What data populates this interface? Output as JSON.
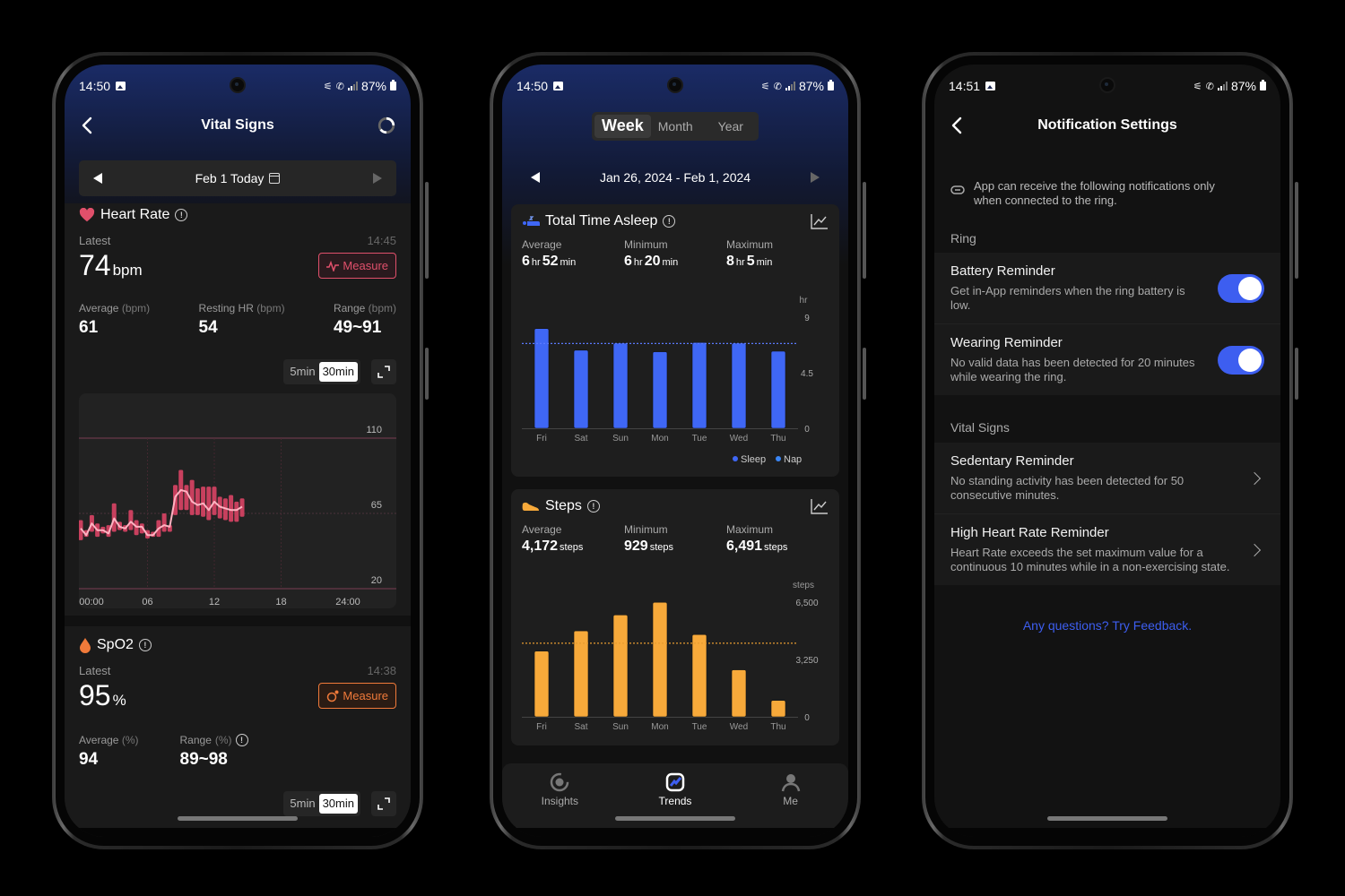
{
  "colors": {
    "accent_blue": "#3d5ef0",
    "heart_red": "#e0506b",
    "spo2_orange": "#f07a3a",
    "steps_orange": "#f7a93a",
    "sleep_blue": "#3f67f5",
    "nap_blue": "#3a86f5"
  },
  "screens": {
    "vital": {
      "status": {
        "time": "14:50",
        "battery": "87%"
      },
      "title": "Vital Signs",
      "date_label": "Feb 1 Today",
      "heart_rate": {
        "title": "Heart Rate",
        "latest_label": "Latest",
        "latest_time": "14:45",
        "value": "74",
        "unit": "bpm",
        "measure_label": "Measure",
        "stats": [
          {
            "label": "Average",
            "unit": "(bpm)",
            "value": "61"
          },
          {
            "label": "Resting HR",
            "unit": "(bpm)",
            "value": "54"
          },
          {
            "label": "Range",
            "unit": "(bpm)",
            "value": "49~91"
          }
        ],
        "interval_options": [
          "5min",
          "30min"
        ],
        "interval_selected": "30min"
      },
      "spo2": {
        "title": "SpO2",
        "latest_label": "Latest",
        "latest_time": "14:38",
        "value": "95",
        "unit": "%",
        "measure_label": "Measure",
        "stats": [
          {
            "label": "Average",
            "unit": "(%)",
            "value": "94"
          },
          {
            "label": "Range",
            "unit": "(%)",
            "value": "89~98"
          }
        ],
        "interval_options": [
          "5min",
          "30min"
        ]
      }
    },
    "trends": {
      "status": {
        "time": "14:50",
        "battery": "87%"
      },
      "period_tabs": [
        "Week",
        "Month",
        "Year"
      ],
      "period_selected": "Week",
      "date_range": "Jan 26, 2024 - Feb 1, 2024",
      "sleep": {
        "title": "Total Time Asleep",
        "stats": [
          {
            "label": "Average",
            "h": "6",
            "m": "52"
          },
          {
            "label": "Minimum",
            "h": "6",
            "m": "20"
          },
          {
            "label": "Maximum",
            "h": "8",
            "m": "5"
          }
        ],
        "hr_unit": "hr",
        "min_unit": "min",
        "legend": [
          "Sleep",
          "Nap"
        ]
      },
      "steps": {
        "title": "Steps",
        "stats": [
          {
            "label": "Average",
            "value": "4,172"
          },
          {
            "label": "Minimum",
            "value": "929"
          },
          {
            "label": "Maximum",
            "value": "6,491"
          }
        ],
        "unit": "steps"
      },
      "tabs": [
        {
          "label": "Insights",
          "icon": "insights-icon"
        },
        {
          "label": "Trends",
          "icon": "trends-icon"
        },
        {
          "label": "Me",
          "icon": "person-icon"
        }
      ],
      "active_tab": "Trends"
    },
    "notif": {
      "status": {
        "time": "14:51",
        "battery": "87%"
      },
      "title": "Notification Settings",
      "notice": "App can receive the following notifications only when connected to the ring.",
      "groups": [
        {
          "label": "Ring",
          "items": [
            {
              "title": "Battery Reminder",
              "desc": "Get in-App reminders when the ring battery is low.",
              "control": "toggle",
              "on": true
            },
            {
              "title": "Wearing Reminder",
              "desc": "No valid data has been detected for 20 minutes while wearing the ring.",
              "control": "toggle",
              "on": true
            }
          ]
        },
        {
          "label": "Vital Signs",
          "items": [
            {
              "title": "Sedentary Reminder",
              "desc": "No standing activity has been detected for 50 consecutive minutes.",
              "control": "chevron"
            },
            {
              "title": "High Heart Rate Reminder",
              "desc": "Heart Rate exceeds the set maximum value for a continuous 10 minutes while in a non-exercising state.",
              "control": "chevron"
            }
          ]
        }
      ],
      "feedback_link": "Any questions? Try Feedback."
    }
  },
  "chart_data": [
    {
      "id": "heart_rate",
      "type": "line",
      "title": "Heart Rate",
      "x_ticks": [
        "00:00",
        "06",
        "12",
        "18",
        "24:00"
      ],
      "y_ticks": [
        20,
        65,
        110
      ],
      "ylim": [
        20,
        110
      ],
      "xlim_hours": [
        0,
        24
      ],
      "grid": true,
      "series": [
        {
          "name": "avg",
          "x_hours": [
            0.0,
            0.5,
            1.0,
            1.5,
            2.0,
            2.5,
            3.0,
            3.5,
            4.0,
            4.5,
            5.0,
            5.5,
            6.0,
            6.5,
            7.0,
            7.5,
            8.0,
            8.5,
            9.0,
            9.5,
            10.0,
            10.5,
            11.0,
            11.5,
            12.0,
            12.5,
            13.0,
            13.5,
            14.0,
            14.5
          ],
          "values": [
            56,
            52,
            59,
            55,
            55,
            53,
            62,
            57,
            56,
            60,
            57,
            57,
            52,
            52,
            56,
            58,
            57,
            75,
            79,
            78,
            72,
            70,
            71,
            67,
            72,
            69,
            68,
            67,
            67,
            69
          ]
        },
        {
          "name": "range_low",
          "values": [
            49,
            51,
            54,
            51,
            53,
            51,
            54,
            55,
            54,
            55,
            52,
            53,
            50,
            51,
            51,
            54,
            54,
            64,
            67,
            67,
            64,
            64,
            63,
            61,
            64,
            62,
            61,
            60,
            60,
            63
          ]
        },
        {
          "name": "range_high",
          "values": [
            61,
            55,
            64,
            59,
            57,
            58,
            71,
            60,
            58,
            67,
            61,
            59,
            55,
            54,
            61,
            65,
            58,
            82,
            91,
            82,
            85,
            80,
            81,
            81,
            81,
            75,
            74,
            76,
            72,
            74
          ]
        }
      ]
    },
    {
      "id": "sleep",
      "type": "bar",
      "title": "Total Time Asleep",
      "categories": [
        "Fri",
        "Sat",
        "Sun",
        "Mon",
        "Tue",
        "Wed",
        "Thu"
      ],
      "series": [
        {
          "name": "Sleep",
          "values": [
            8.08,
            6.33,
            6.9,
            6.2,
            6.95,
            6.9,
            6.25
          ]
        }
      ],
      "average": 6.87,
      "y_ticks": [
        0,
        4.5,
        9
      ],
      "ylabel": "hr",
      "ylim": [
        0,
        9
      ],
      "legend": [
        "Sleep",
        "Nap"
      ],
      "legend_position": "bottom-right"
    },
    {
      "id": "steps",
      "type": "bar",
      "title": "Steps",
      "categories": [
        "Fri",
        "Sat",
        "Sun",
        "Mon",
        "Tue",
        "Wed",
        "Thu"
      ],
      "series": [
        {
          "name": "Steps",
          "values": [
            3720,
            4870,
            5770,
            6491,
            4660,
            2660,
            929
          ]
        }
      ],
      "average": 4172,
      "y_ticks": [
        "0",
        "3,250",
        "6,500"
      ],
      "ylabel": "steps",
      "ylim": [
        0,
        6500
      ]
    }
  ]
}
